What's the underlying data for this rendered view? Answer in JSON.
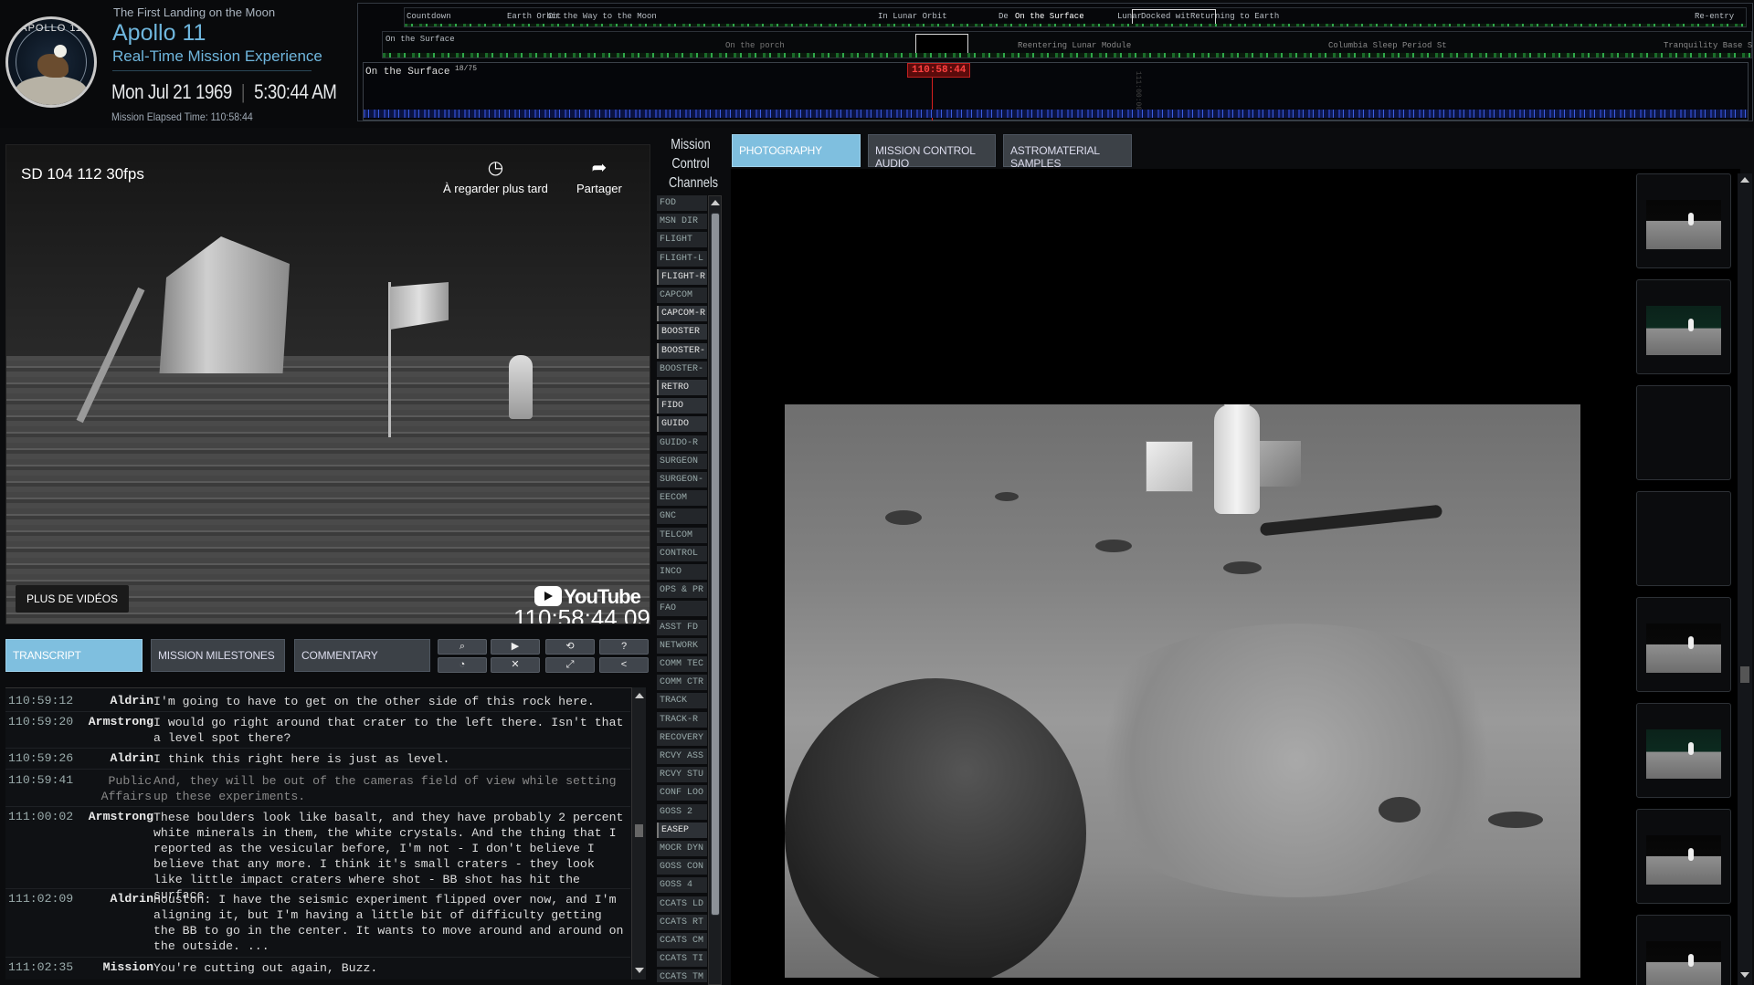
{
  "header": {
    "tagline": "The First Landing on the Moon",
    "title": "Apollo 11",
    "subtitle": "Real-Time Mission Experience",
    "date": "Mon Jul 21 1969",
    "time": "5:30:44 AM",
    "met_label": "Mission Elapsed Time: 110:58:44",
    "logo_text": "APOLLO 11"
  },
  "timeline": {
    "phases": [
      "Countdown",
      "Earth Orbit",
      "On the Way to the Moon",
      "In Lunar Orbit",
      "De",
      "On the Surface",
      "Lunar",
      "Docked wit",
      "Returning to Earth",
      "Re-entry"
    ],
    "mid_labels": [
      "On the Surface",
      "On the porch",
      "Reentering Lunar Module",
      "Columbia Sleep Period St",
      "Tranquility Base S"
    ],
    "zoom_label": "On the Surface",
    "zoom_count": "18/75",
    "current": "110:58:44",
    "marker_faint": "111:00:00"
  },
  "video": {
    "title": "SD 104 112 30fps",
    "watch_later": "À regarder plus tard",
    "share": "Partager",
    "more_videos": "PLUS DE VIDÉOS",
    "brand": "YouTube",
    "timestamp": "110:58:44.09"
  },
  "left_tabs": [
    "TRANSCRIPT",
    "MISSION MILESTONES",
    "COMMENTARY"
  ],
  "controls": [
    {
      "icon": "search-icon",
      "glyph": "⌕"
    },
    {
      "icon": "play-icon",
      "glyph": "▶"
    },
    {
      "icon": "history-icon",
      "glyph": "⟲"
    },
    {
      "icon": "help-icon",
      "glyph": "?"
    },
    {
      "icon": "speed-icon",
      "glyph": "◔"
    },
    {
      "icon": "mute-icon",
      "glyph": "✕"
    },
    {
      "icon": "fullscreen-icon",
      "glyph": "⤢"
    },
    {
      "icon": "share-icon",
      "glyph": "<"
    }
  ],
  "transcript": [
    {
      "t": "110:59:12",
      "who": "Aldrin",
      "text": "I'm going to have to get on the other side of this rock here."
    },
    {
      "t": "110:59:20",
      "who": "Armstrong",
      "text": "I would go right around that crater to the left there. Isn't that a level spot there?"
    },
    {
      "t": "110:59:26",
      "who": "Aldrin",
      "text": "I think this right here is just as level."
    },
    {
      "t": "110:59:41",
      "who": "Public Affairs",
      "text": "And, they will be out of the cameras field of view while setting up these experiments."
    },
    {
      "t": "111:00:02",
      "who": "Armstrong",
      "text": "These boulders look like basalt, and they have probably 2 percent white minerals in them, the white crystals. And the thing that I reported as the vesicular before, I'm not - I don't believe I believe that any more. I think it's small craters - they look like little impact craters where shot - BB shot has hit the surface."
    },
    {
      "t": "111:02:09",
      "who": "Aldrin",
      "text": "Houston. I have the seismic experiment flipped over now, and I'm aligning it, but I'm having a little bit of difficulty getting the BB to go in the center. It wants to move around and around on the outside. ..."
    },
    {
      "t": "111:02:35",
      "who": "Mission",
      "text": "You're cutting out again, Buzz."
    }
  ],
  "channels": {
    "heading": "Mission Control Channels",
    "items": [
      {
        "label": "FOD",
        "on": false
      },
      {
        "label": "MSN DIR",
        "on": false
      },
      {
        "label": "FLIGHT",
        "on": false
      },
      {
        "label": "FLIGHT-L",
        "on": false
      },
      {
        "label": "FLIGHT-R",
        "on": true
      },
      {
        "label": "CAPCOM",
        "on": false
      },
      {
        "label": "CAPCOM-R",
        "on": true
      },
      {
        "label": "BOOSTER",
        "on": true
      },
      {
        "label": "BOOSTER-",
        "on": true
      },
      {
        "label": "BOOSTER-",
        "on": false
      },
      {
        "label": "RETRO",
        "on": true
      },
      {
        "label": "FIDO",
        "on": true
      },
      {
        "label": "GUIDO",
        "on": true
      },
      {
        "label": "GUIDO-R",
        "on": false
      },
      {
        "label": "SURGEON",
        "on": false
      },
      {
        "label": "SURGEON-",
        "on": false
      },
      {
        "label": "EECOM",
        "on": false
      },
      {
        "label": "GNC",
        "on": false
      },
      {
        "label": "TELCOM",
        "on": false
      },
      {
        "label": "CONTROL",
        "on": false
      },
      {
        "label": "INCO",
        "on": false
      },
      {
        "label": "OPS & PR",
        "on": false
      },
      {
        "label": "FAO",
        "on": false
      },
      {
        "label": "ASST FD",
        "on": false
      },
      {
        "label": "NETWORK",
        "on": false
      },
      {
        "label": "COMM TEC",
        "on": false
      },
      {
        "label": "COMM CTR",
        "on": false
      },
      {
        "label": "TRACK",
        "on": false
      },
      {
        "label": "TRACK-R",
        "on": false
      },
      {
        "label": "RECOVERY",
        "on": false
      },
      {
        "label": "RCVY ASS",
        "on": false
      },
      {
        "label": "RCVY STU",
        "on": false
      },
      {
        "label": "CONF LOO",
        "on": false
      },
      {
        "label": "GOSS 2",
        "on": false
      },
      {
        "label": "EASEP",
        "on": true
      },
      {
        "label": "MOCR DYN",
        "on": false
      },
      {
        "label": "GOSS CON",
        "on": false
      },
      {
        "label": "GOSS 4",
        "on": false
      },
      {
        "label": "CCATS LD",
        "on": false
      },
      {
        "label": "CCATS RT",
        "on": false
      },
      {
        "label": "CCATS CM",
        "on": false
      },
      {
        "label": "CCATS TI",
        "on": false
      },
      {
        "label": "CCATS TM",
        "on": false
      }
    ]
  },
  "right_tabs": [
    "PHOTOGRAPHY",
    "MISSION CONTROL AUDIO",
    "ASTROMATERIAL SAMPLES"
  ],
  "thumbnails": [
    {
      "kind": "dark"
    },
    {
      "kind": "green"
    },
    {
      "kind": "empty"
    },
    {
      "kind": "empty"
    },
    {
      "kind": "dark"
    },
    {
      "kind": "green"
    },
    {
      "kind": "dark"
    },
    {
      "kind": "dark"
    }
  ],
  "colors": {
    "accent": "#7fbfdf",
    "title": "#6fb6dd",
    "marker": "#d81f1f"
  }
}
